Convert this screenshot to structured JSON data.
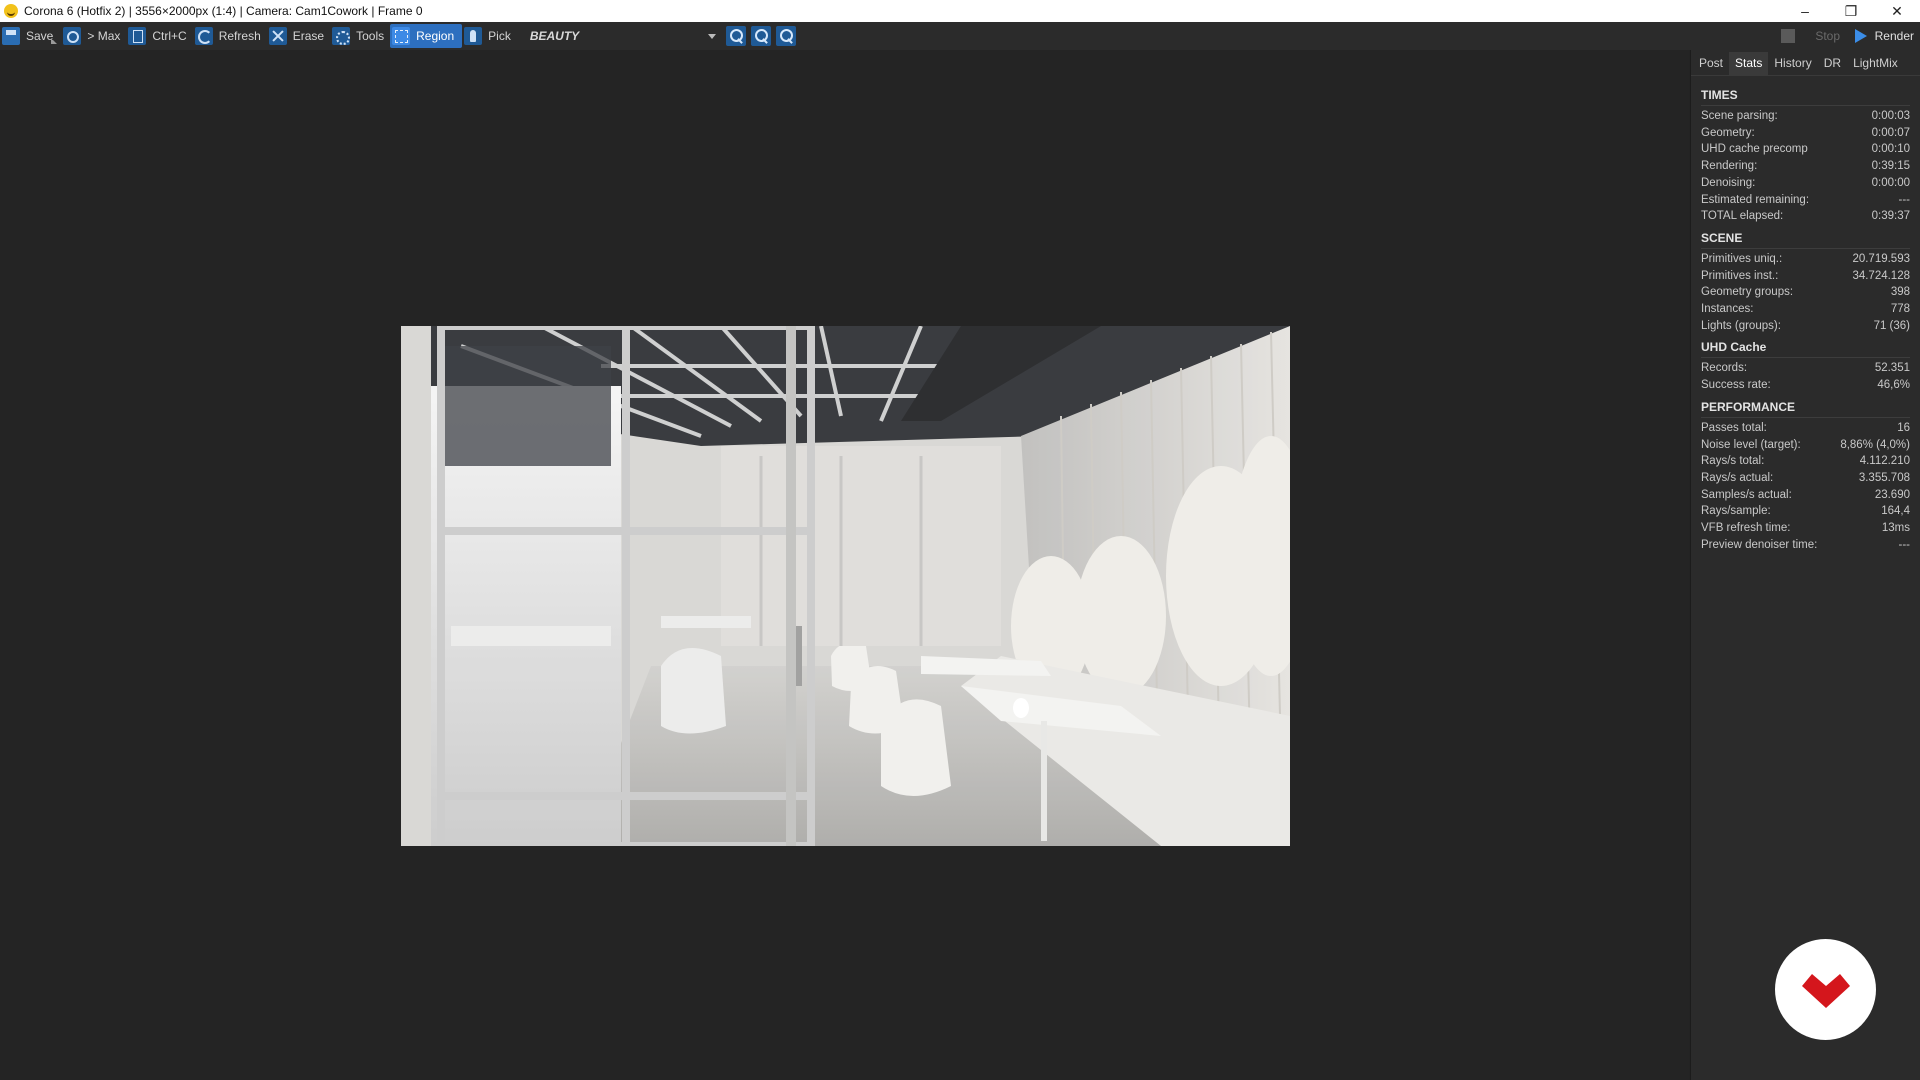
{
  "window": {
    "title": "Corona 6 (Hotfix 2) | 3556×2000px (1:4) | Camera: Cam1Cowork | Frame 0",
    "controls": {
      "minimize": "–",
      "restore": "❐",
      "close": "✕"
    }
  },
  "toolbar": {
    "save": "Save",
    "max": "> Max",
    "copy": "Ctrl+C",
    "refresh": "Refresh",
    "erase": "Erase",
    "tools": "Tools",
    "region": "Region",
    "pick": "Pick",
    "render_pass": "BEAUTY",
    "stop": "Stop",
    "render": "Render"
  },
  "panel": {
    "tabs": [
      {
        "label": "Post",
        "active": false
      },
      {
        "label": "Stats",
        "active": true
      },
      {
        "label": "History",
        "active": false
      },
      {
        "label": "DR",
        "active": false
      },
      {
        "label": "LightMix",
        "active": false
      }
    ],
    "sections": [
      {
        "title": "TIMES",
        "rows": [
          {
            "label": "Scene parsing:",
            "value": "0:00:03"
          },
          {
            "label": "Geometry:",
            "value": "0:00:07"
          },
          {
            "label": "UHD cache precomp",
            "value": "0:00:10"
          },
          {
            "label": "Rendering:",
            "value": "0:39:15"
          },
          {
            "label": "Denoising:",
            "value": "0:00:00"
          },
          {
            "label": "Estimated remaining:",
            "value": "---"
          },
          {
            "label": "TOTAL elapsed:",
            "value": "0:39:37"
          }
        ]
      },
      {
        "title": "SCENE",
        "rows": [
          {
            "label": "Primitives uniq.:",
            "value": "20.719.593"
          },
          {
            "label": "Primitives inst.:",
            "value": "34.724.128"
          },
          {
            "label": "Geometry groups:",
            "value": "398"
          },
          {
            "label": "Instances:",
            "value": "778"
          },
          {
            "label": "Lights (groups):",
            "value": "71 (36)"
          }
        ]
      },
      {
        "title": "UHD Cache",
        "rows": [
          {
            "label": "Records:",
            "value": "52.351"
          },
          {
            "label": "Success rate:",
            "value": "46,6%"
          }
        ]
      },
      {
        "title": "PERFORMANCE",
        "rows": [
          {
            "label": "Passes total:",
            "value": "16"
          },
          {
            "label": "Noise level (target):",
            "value": "8,86% (4,0%)"
          },
          {
            "label": "Rays/s total:",
            "value": "4.112.210"
          },
          {
            "label": "Rays/s actual:",
            "value": "3.355.708"
          },
          {
            "label": "Samples/s actual:",
            "value": "23.690"
          },
          {
            "label": "Rays/sample:",
            "value": "164,4"
          },
          {
            "label": "VFB refresh time:",
            "value": "13ms"
          },
          {
            "label": "Preview denoiser time:",
            "value": "---"
          }
        ]
      }
    ]
  },
  "colors": {
    "accent": "#2d6fbf",
    "background": "#242424",
    "panel": "#2b2b2b",
    "badge_red": "#d4161c"
  }
}
